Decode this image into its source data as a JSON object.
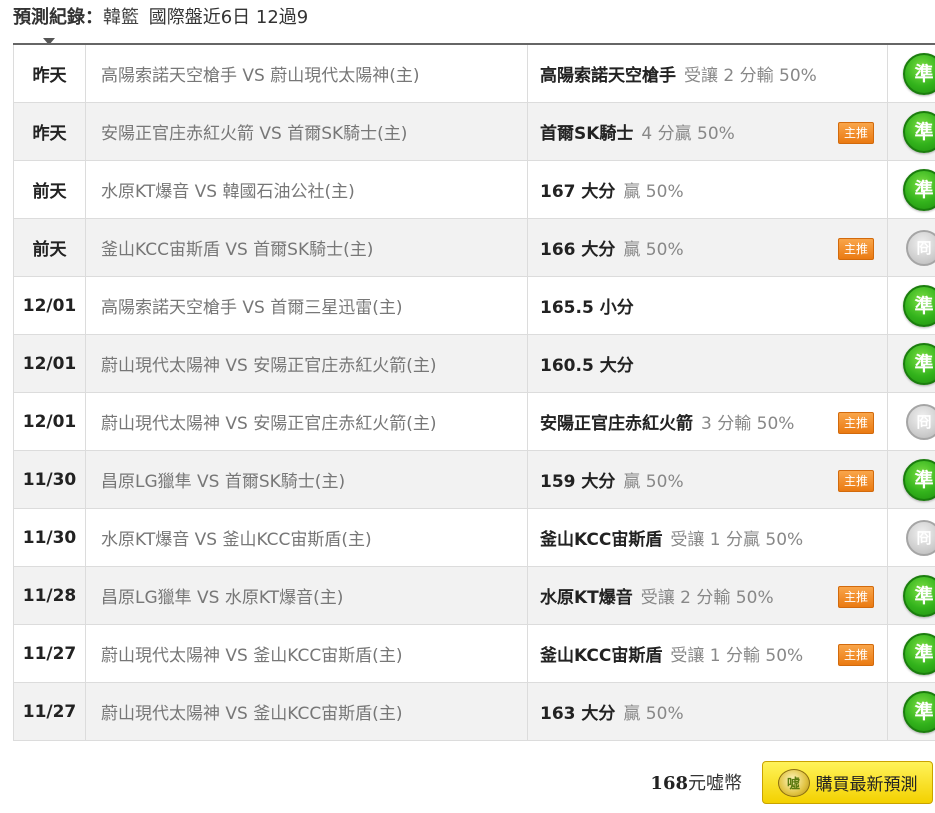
{
  "header": {
    "label": "預測紀錄：",
    "league": "韓籃",
    "summary": "國際盤近6日 12過9"
  },
  "records": [
    {
      "date": "昨天",
      "match": "高陽索諾天空槍手 VS 蔚山現代太陽神(主)",
      "pick_team": "高陽索諾天空槍手",
      "pick_odds": "受讓 2 分輸 50%",
      "tag": "",
      "result": "準"
    },
    {
      "date": "昨天",
      "match": "安陽正官庄赤紅火箭 VS 首爾SK騎士(主)",
      "pick_team": "首爾SK騎士",
      "pick_odds": "4 分贏 50%",
      "tag": "主推",
      "result": "準"
    },
    {
      "date": "前天",
      "match": "水原KT爆音 VS 韓國石油公社(主)",
      "pick_team": "167 大分",
      "pick_odds": "贏 50%",
      "tag": "",
      "result": "準"
    },
    {
      "date": "前天",
      "match": "釜山KCC宙斯盾 VS 首爾SK騎士(主)",
      "pick_team": "166 大分",
      "pick_odds": "贏 50%",
      "tag": "主推",
      "result": "冏"
    },
    {
      "date": "12/01",
      "match": "高陽索諾天空槍手 VS 首爾三星迅雷(主)",
      "pick_team": "165.5 小分",
      "pick_odds": "",
      "tag": "",
      "result": "準"
    },
    {
      "date": "12/01",
      "match": "蔚山現代太陽神 VS 安陽正官庄赤紅火箭(主)",
      "pick_team": "160.5 大分",
      "pick_odds": "",
      "tag": "",
      "result": "準"
    },
    {
      "date": "12/01",
      "match": "蔚山現代太陽神 VS 安陽正官庄赤紅火箭(主)",
      "pick_team": "安陽正官庄赤紅火箭",
      "pick_odds": "3 分輸 50%",
      "tag": "主推",
      "result": "冏"
    },
    {
      "date": "11/30",
      "match": "昌原LG獵隼 VS 首爾SK騎士(主)",
      "pick_team": "159 大分",
      "pick_odds": "贏 50%",
      "tag": "主推",
      "result": "準"
    },
    {
      "date": "11/30",
      "match": "水原KT爆音 VS 釜山KCC宙斯盾(主)",
      "pick_team": "釜山KCC宙斯盾",
      "pick_odds": "受讓 1 分贏 50%",
      "tag": "",
      "result": "冏"
    },
    {
      "date": "11/28",
      "match": "昌原LG獵隼 VS 水原KT爆音(主)",
      "pick_team": "水原KT爆音",
      "pick_odds": "受讓 2 分輸 50%",
      "tag": "主推",
      "result": "準"
    },
    {
      "date": "11/27",
      "match": "蔚山現代太陽神 VS 釜山KCC宙斯盾(主)",
      "pick_team": "釜山KCC宙斯盾",
      "pick_odds": "受讓 1 分輸 50%",
      "tag": "主推",
      "result": "準"
    },
    {
      "date": "11/27",
      "match": "蔚山現代太陽神 VS 釜山KCC宙斯盾(主)",
      "pick_team": "163 大分",
      "pick_odds": "贏 50%",
      "tag": "",
      "result": "準"
    }
  ],
  "footer": {
    "price": "168",
    "unit": "元噓幣",
    "buy_label": "購買最新預測",
    "coin_text": "噓"
  }
}
